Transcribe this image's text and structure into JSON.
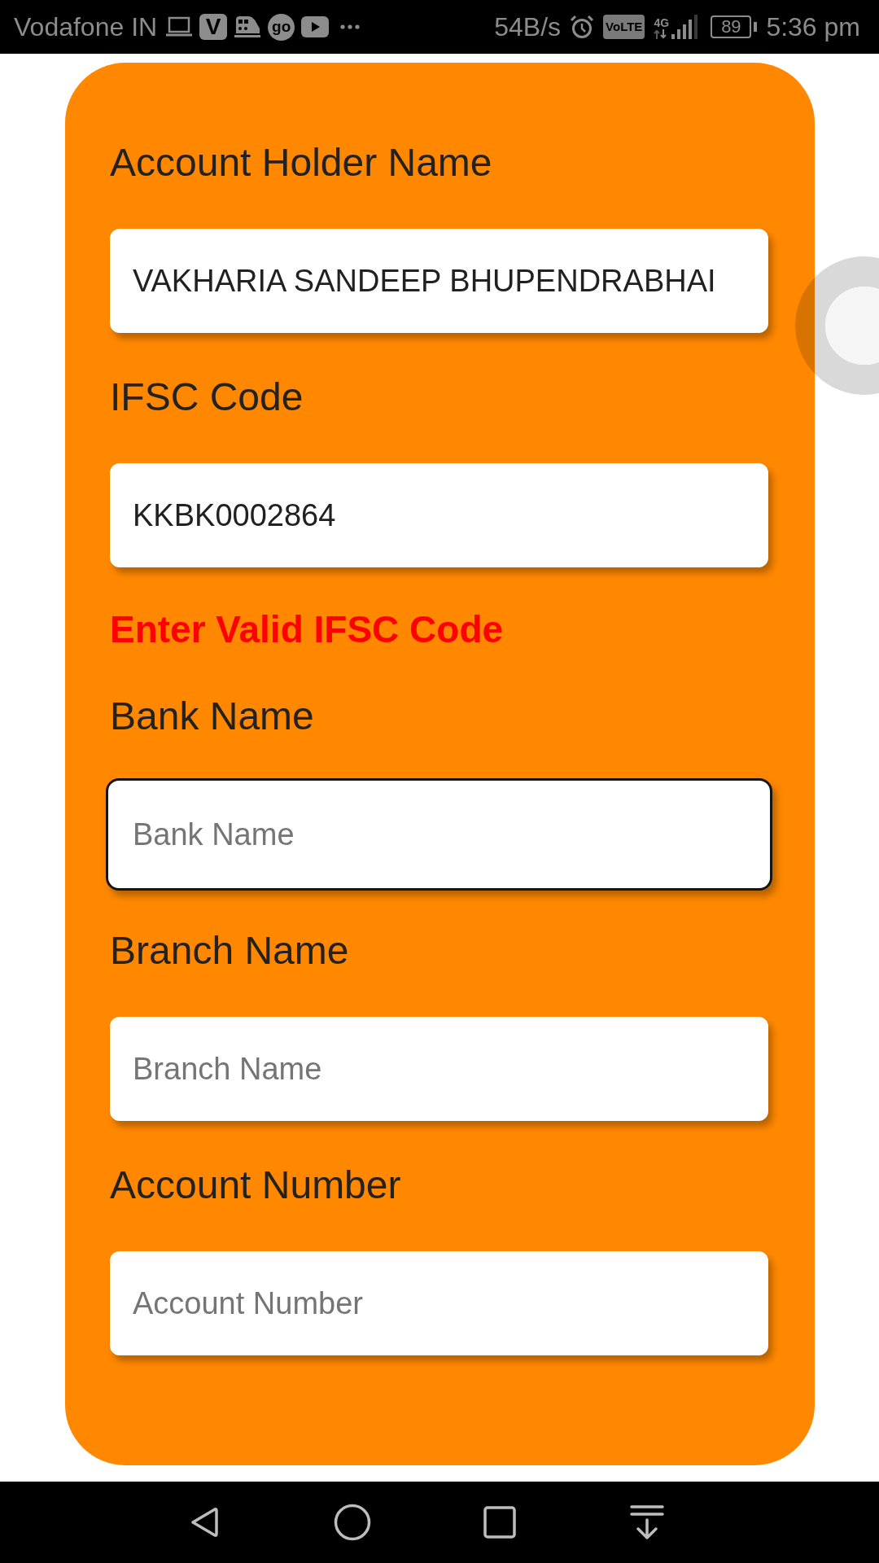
{
  "status_bar": {
    "carrier": "Vodafone IN",
    "notifications": [
      {
        "kind": "laptop"
      },
      {
        "kind": "tile",
        "label": "V"
      },
      {
        "kind": "train"
      },
      {
        "kind": "disc",
        "label": "go"
      },
      {
        "kind": "play"
      },
      {
        "kind": "more"
      }
    ],
    "speed": "54B/s",
    "volte": "VoLTE",
    "network": "4G",
    "battery": "89",
    "time": "5:36 pm"
  },
  "form": {
    "fields": [
      {
        "label": "Account Holder Name",
        "value": "VAKHARIA SANDEEP BHUPENDRABHAI",
        "focused": false
      },
      {
        "label": "IFSC Code",
        "value": "KKBK0002864",
        "focused": false,
        "error": "Enter Valid IFSC Code"
      },
      {
        "label": "Bank Name",
        "placeholder": "Bank Name",
        "focused": true
      },
      {
        "label": "Branch Name",
        "placeholder": "Branch Name",
        "focused": false
      },
      {
        "label": "Account Number",
        "placeholder": "Account Number",
        "focused": false
      }
    ]
  },
  "nav_bar": {
    "buttons": [
      {
        "kind": "back"
      },
      {
        "kind": "home"
      },
      {
        "kind": "recents"
      },
      {
        "kind": "pull_down"
      }
    ]
  }
}
